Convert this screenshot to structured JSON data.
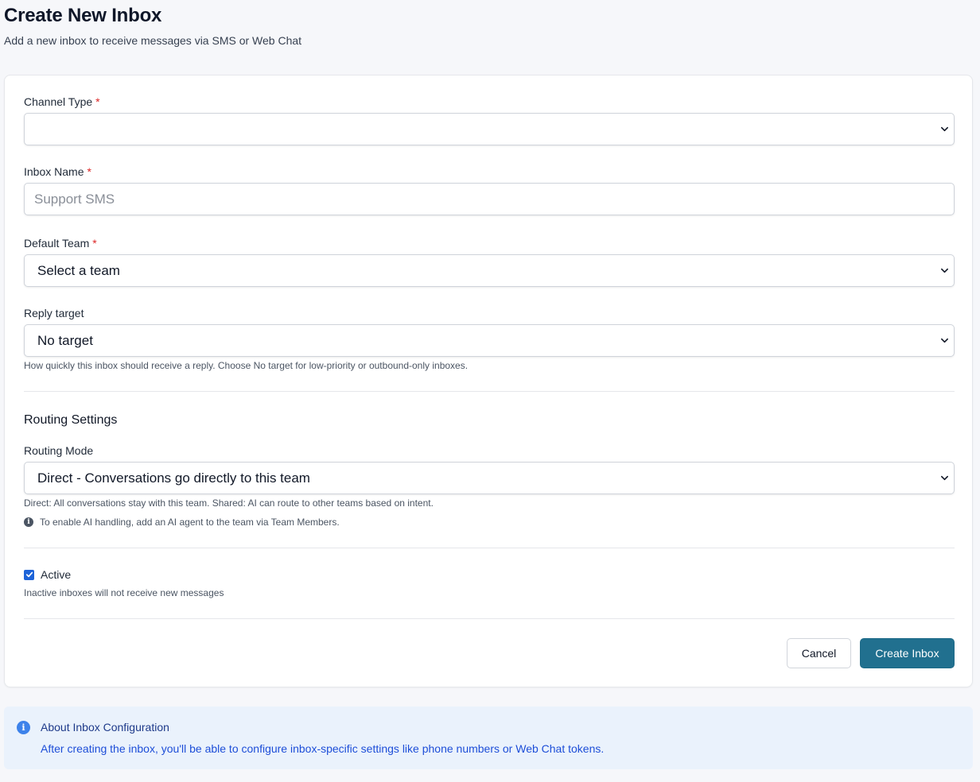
{
  "header": {
    "title": "Create New Inbox",
    "subtitle": "Add a new inbox to receive messages via SMS or Web Chat"
  },
  "form": {
    "channel_type": {
      "label": "Channel Type",
      "required_mark": "*",
      "value": ""
    },
    "inbox_name": {
      "label": "Inbox Name",
      "required_mark": "*",
      "placeholder": "Support SMS",
      "value": ""
    },
    "default_team": {
      "label": "Default Team",
      "required_mark": "*",
      "value": "Select a team"
    },
    "reply_target": {
      "label": "Reply target",
      "value": "No target",
      "help": "How quickly this inbox should receive a reply. Choose No target for low-priority or outbound-only inboxes."
    },
    "routing": {
      "section_title": "Routing Settings",
      "mode_label": "Routing Mode",
      "mode_value": "Direct - Conversations go directly to this team",
      "help": "Direct: All conversations stay with this team. Shared: AI can route to other teams based on intent.",
      "info": "To enable AI handling, add an AI agent to the team via Team Members."
    },
    "active": {
      "label": "Active",
      "checked": true,
      "help": "Inactive inboxes will not receive new messages"
    },
    "actions": {
      "cancel_label": "Cancel",
      "create_label": "Create Inbox"
    }
  },
  "info_box": {
    "title": "About Inbox Configuration",
    "body": "After creating the inbox, you'll be able to configure inbox-specific settings like phone numbers or Web Chat tokens."
  },
  "icons": {
    "select": "chevron-down-icon",
    "info": "info-icon",
    "check": "checkmark-icon"
  },
  "colors": {
    "primary": "#21708f",
    "required": "#dc2626",
    "checkbox": "#1d63d8",
    "info_bg": "#eaf2fc",
    "info_text": "#1d4ed8"
  }
}
